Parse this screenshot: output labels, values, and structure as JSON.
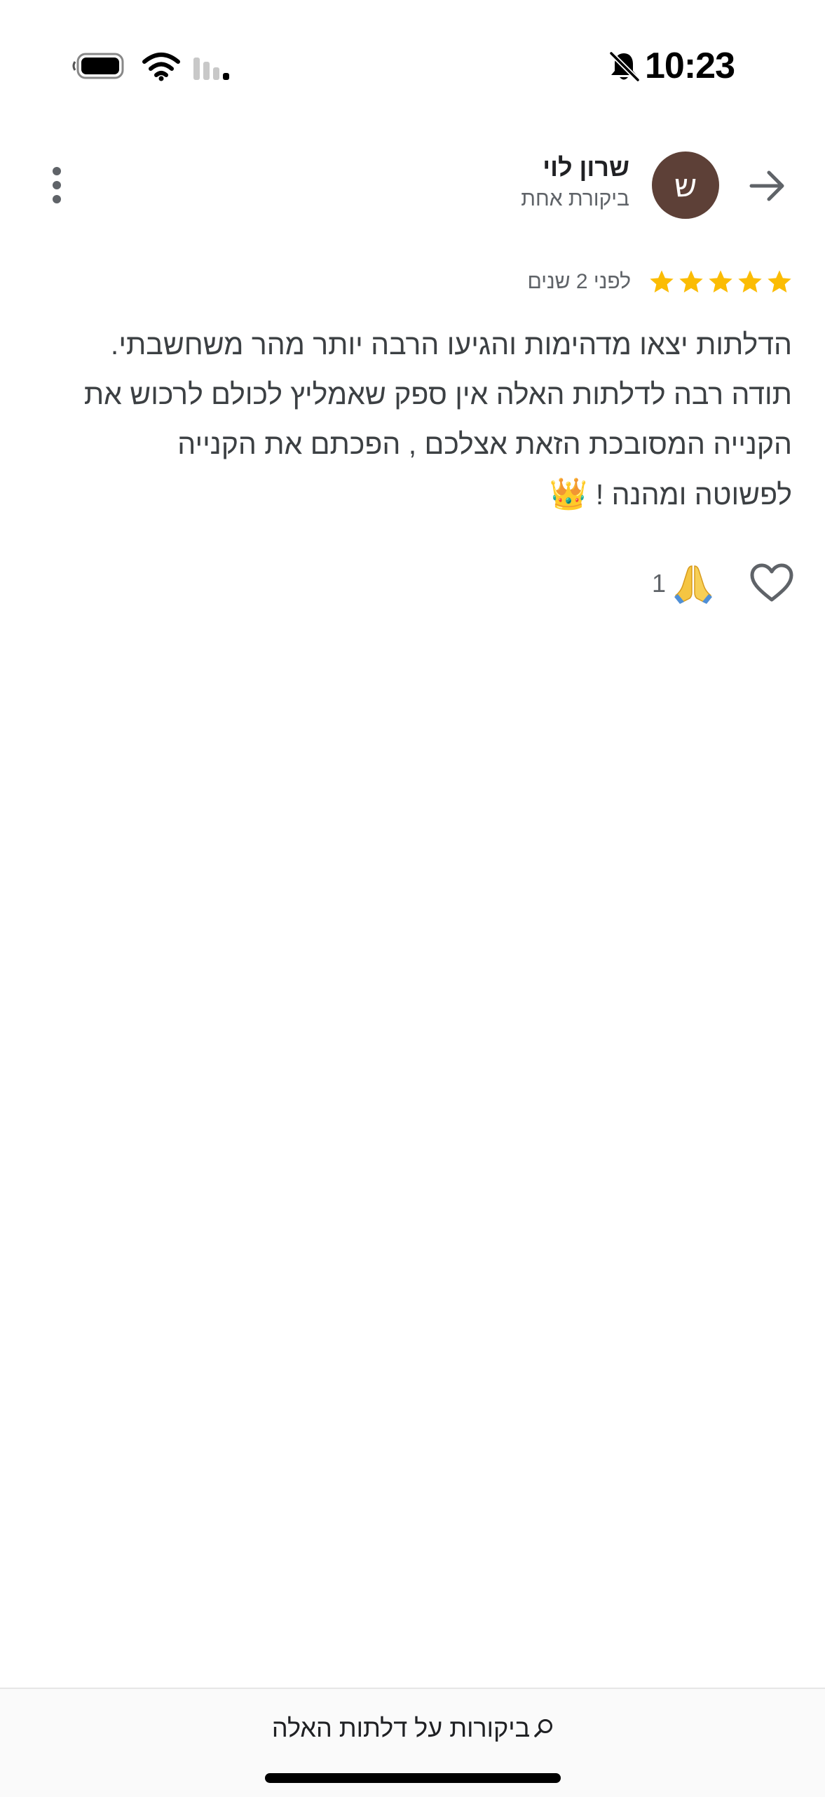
{
  "status_bar": {
    "time": "10:23"
  },
  "reviewer": {
    "avatar_letter": "ש",
    "avatar_color": "#5d4037",
    "name": "שרון לוי",
    "review_count": "ביקורת אחת"
  },
  "review": {
    "rating": 5,
    "star_color": "#fbbc04",
    "date": "לפני 2 שנים",
    "lines": [
      "הדלתות יצאו מדהימות והגיעו הרבה יותר מהר משחשבתי.",
      "תודה רבה לדלתות האלה אין ספק שאמליץ לכולם לרכוש את",
      "הקנייה המסובכת הזאת אצלכם , הפכתם את הקנייה",
      "לפשוטה ומהנה !"
    ],
    "trailing_emoji": "👑"
  },
  "reactions": {
    "like_icon": "heart-outline-icon",
    "reaction_icon": "folded-hands-icon",
    "count": "1"
  },
  "bottom_bar": {
    "search_label": "ביקורות על דלתות האלה",
    "search_icon": "search-icon"
  },
  "icons": {
    "back": "arrow-right-icon",
    "more": "more-vert-icon",
    "notifications": "bell-off-icon",
    "battery": "battery-icon",
    "wifi": "wifi-icon",
    "signal": "signal-icon"
  }
}
